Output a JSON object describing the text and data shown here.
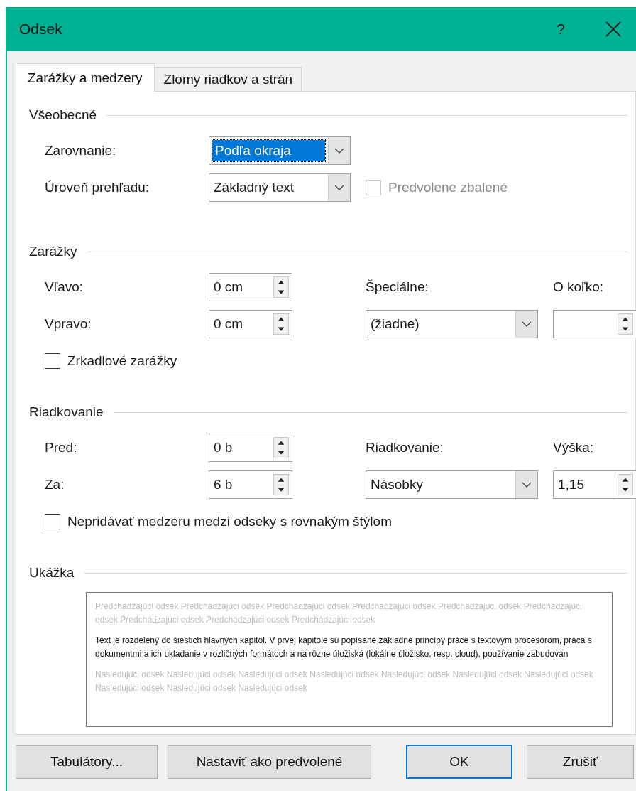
{
  "window": {
    "title": "Odsek",
    "help": "?"
  },
  "tabs": [
    {
      "label": "Zarážky a medzery",
      "selected": true
    },
    {
      "label": "Zlomy riadkov a strán",
      "selected": false
    }
  ],
  "sections": [
    {
      "heading": "Všeobecné",
      "rows": [
        [
          {
            "kind": "label",
            "text": "Zarovnanie:"
          },
          {
            "kind": "dropdown",
            "value": "Podľa okraja",
            "focused": true
          }
        ],
        [
          {
            "kind": "label",
            "text": "Úroveň prehľadu:"
          },
          {
            "kind": "dropdown",
            "value": "Základný text",
            "focused": false
          },
          {
            "kind": "checkbox",
            "text": "Predvolene zbalené",
            "checked": false,
            "disabled": true
          }
        ]
      ]
    },
    {
      "heading": "Zarážky",
      "rows": [
        [
          {
            "kind": "label",
            "text": "Vľavo:"
          },
          {
            "kind": "spin",
            "value": "0 cm"
          },
          {
            "kind": "label",
            "text": "Špeciálne:"
          },
          {
            "kind": "label",
            "text": "O koľko:"
          }
        ],
        [
          {
            "kind": "label",
            "text": "Vpravo:"
          },
          {
            "kind": "spin",
            "value": "0 cm"
          },
          {
            "kind": "dropdown",
            "value": "(žiadne)",
            "focused": false
          },
          {
            "kind": "spin"
          }
        ],
        [
          {
            "kind": "checkbox",
            "text": "Zrkadlové zarážky",
            "checked": false,
            "disabled": false
          }
        ]
      ]
    },
    {
      "heading": "Riadkovanie",
      "rows": [
        [
          {
            "kind": "label",
            "text": "Pred:"
          },
          {
            "kind": "spin",
            "value": "0 b"
          },
          {
            "kind": "label",
            "text": "Riadkovanie:"
          },
          {
            "kind": "label",
            "text": "Výška:"
          }
        ],
        [
          {
            "kind": "label",
            "text": "Za:"
          },
          {
            "kind": "spin",
            "value": "6 b"
          },
          {
            "kind": "dropdown",
            "value": "Násobky",
            "focused": false
          },
          {
            "kind": "spin",
            "value": "1,15"
          }
        ],
        [
          {
            "kind": "checkbox",
            "text": "Nepridávať medzeru medzi odseky s rovnakým štýlom",
            "checked": false,
            "disabled": false
          }
        ]
      ]
    }
  ],
  "preview": {
    "heading": "Ukážka",
    "previous": "Predchádzajúci odsek Predchádzajúci odsek Predchádzajúci odsek Predchádzajúci odsek Predchádzajúci odsek Predchádzajúci odsek Predchádzajúci odsek Predchádzajúci odsek Predchádzajúci odsek",
    "text": "Text je rozdelený do šiestich hlavných kapitol. V prvej kapitole sú popísané základné princípy práce s textovým procesorom, práca s dokumentmi a ich ukladanie v rozličných formátoch a na rôzne úložiská (lokálne úložisko, resp. cloud), používanie zabudovan",
    "next": "Nasledujúci odsek Nasledujúci odsek Nasledujúci odsek Nasledujúci odsek Nasledujúci odsek Nasledujúci odsek Nasledujúci odsek Nasledujúci odsek Nasledujúci odsek Nasledujúci odsek"
  },
  "buttons": [
    {
      "label": "Tabulátory...",
      "default": false
    },
    {
      "label": "Nastaviť ako predvolené",
      "default": false
    },
    {
      "label": "OK",
      "default": true
    },
    {
      "label": "Zrušiť",
      "default": false
    }
  ]
}
